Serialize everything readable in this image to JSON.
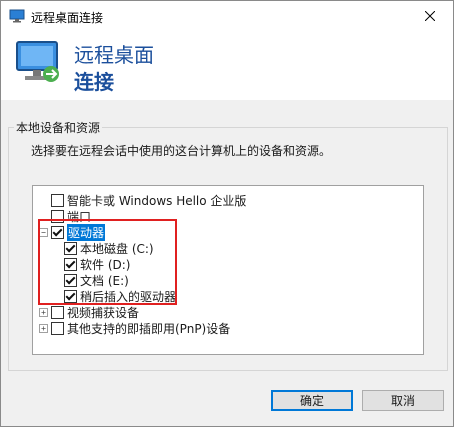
{
  "window": {
    "title": "远程桌面连接"
  },
  "header": {
    "line1": "远程桌面",
    "line2": "连接"
  },
  "group": {
    "label": "本地设备和资源",
    "description": "选择要在远程会话中使用的这台计算机上的设备和资源。"
  },
  "tree": {
    "smartcard": {
      "label": "智能卡或 Windows Hello 企业版",
      "checked": false
    },
    "ports": {
      "label": "端口",
      "checked": false
    },
    "drives": {
      "label": "驱动器",
      "checked": true,
      "expanded": true,
      "children": [
        {
          "label": "本地磁盘 (C:)",
          "checked": true
        },
        {
          "label": "软件 (D:)",
          "checked": true
        },
        {
          "label": "文档 (E:)",
          "checked": true
        },
        {
          "label": "稍后插入的驱动器",
          "checked": true
        }
      ]
    },
    "video": {
      "label": "视频捕获设备",
      "checked": false
    },
    "pnp": {
      "label": "其他支持的即插即用(PnP)设备",
      "checked": false
    }
  },
  "buttons": {
    "ok": "确定",
    "cancel": "取消"
  },
  "colors": {
    "header_text": "#1b4f9c",
    "selection": "#0078d7",
    "annotation": "#e02020"
  },
  "icons": {
    "title": "remote-desktop-icon",
    "header": "monitor-connect-icon",
    "close": "close-icon"
  }
}
